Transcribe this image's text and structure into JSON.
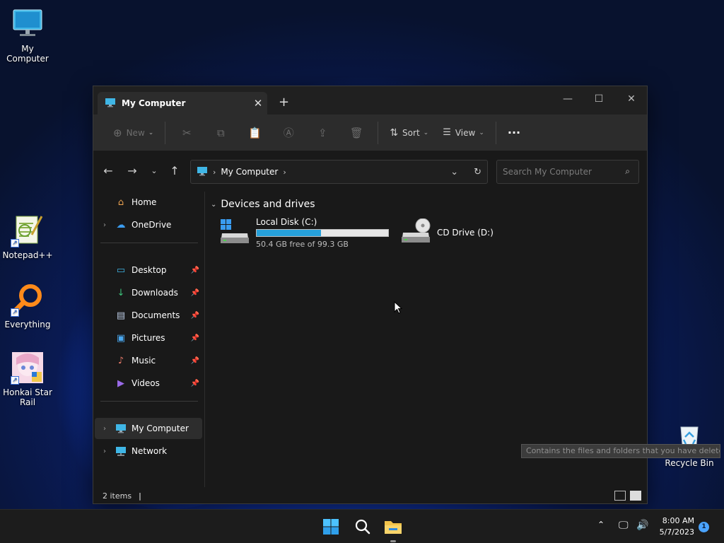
{
  "desktop": {
    "icons": [
      {
        "label": "My Computer",
        "icon": "computer-icon"
      },
      {
        "label": "Notepad++",
        "icon": "notepad-plus-plus-icon"
      },
      {
        "label": "Everything",
        "icon": "everything-search-icon"
      },
      {
        "label": "Honkai Star Rail",
        "icon": "honkai-star-rail-icon"
      },
      {
        "label": "Recycle Bin",
        "icon": "recycle-bin-icon"
      }
    ],
    "tooltip": "Contains the files and folders that you have deleted."
  },
  "window": {
    "tab_title": "My Computer",
    "new_tab_symbol": "+",
    "toolbar": {
      "new_label": "New",
      "sort_label": "Sort",
      "view_label": "View",
      "more_label": "···"
    },
    "address": {
      "crumb": "My Computer"
    },
    "search": {
      "placeholder": "Search My Computer"
    },
    "sidebar": {
      "top": [
        {
          "label": "Home"
        },
        {
          "label": "OneDrive"
        }
      ],
      "quick_access": [
        {
          "label": "Desktop"
        },
        {
          "label": "Downloads"
        },
        {
          "label": "Documents"
        },
        {
          "label": "Pictures"
        },
        {
          "label": "Music"
        },
        {
          "label": "Videos"
        }
      ],
      "bottom": [
        {
          "label": "My Computer"
        },
        {
          "label": "Network"
        }
      ]
    },
    "content": {
      "section_title": "Devices and drives",
      "drives": [
        {
          "name": "Local Disk (C:)",
          "free_text": "50.4 GB free of 99.3 GB",
          "used_fraction": 0.49
        },
        {
          "name": "CD Drive (D:)"
        }
      ]
    },
    "status": {
      "items_text": "2 items"
    }
  },
  "taskbar": {
    "time": "8:00 AM",
    "date": "5/7/2023",
    "notification_count": "1"
  },
  "colors": {
    "accent": "#26a0da",
    "window_bg": "#191919",
    "toolbar_bg": "#2c2c2c"
  }
}
